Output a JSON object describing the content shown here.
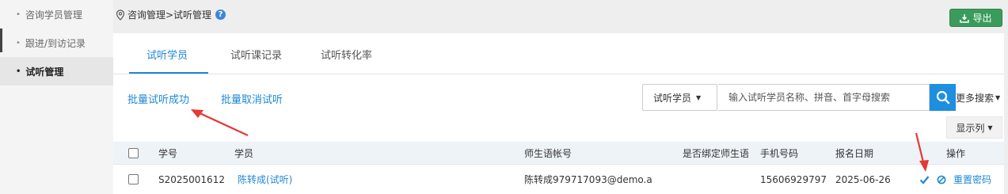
{
  "sidebar": {
    "items": [
      {
        "label": "咨询学员管理",
        "active": false
      },
      {
        "label": "跟进/到访记录",
        "active": false
      },
      {
        "label": "试听管理",
        "active": true
      }
    ]
  },
  "breadcrumb": {
    "text": "咨询管理>试听管理",
    "help": "?"
  },
  "toolbar": {
    "export_label": "导出"
  },
  "tabs": [
    {
      "label": "试听学员",
      "active": true
    },
    {
      "label": "试听课记录",
      "active": false
    },
    {
      "label": "试听转化率",
      "active": false
    }
  ],
  "actions": {
    "batch_success": "批量试听成功",
    "batch_cancel": "批量取消试听"
  },
  "search": {
    "select_value": "试听学员",
    "placeholder": "输入试听学员名称、拼音、首字母搜索",
    "more_label": "更多搜索"
  },
  "display_cols_label": "显示列",
  "table": {
    "headers": [
      "学号",
      "学员",
      "师生语帐号",
      "是否绑定师生语",
      "手机号码",
      "报名日期",
      "操作"
    ],
    "rows": [
      {
        "student_no": "S2025001612",
        "student": "陈转成(试听)",
        "account": "陈转成979717093@demo.a",
        "bound": "",
        "phone": "15606929797",
        "signup_date": "2025-06-26",
        "reset_label": "重置密码"
      }
    ]
  },
  "colors": {
    "accent": "#1e88d6",
    "export": "#3a9b5d",
    "annotation": "#e53935"
  }
}
